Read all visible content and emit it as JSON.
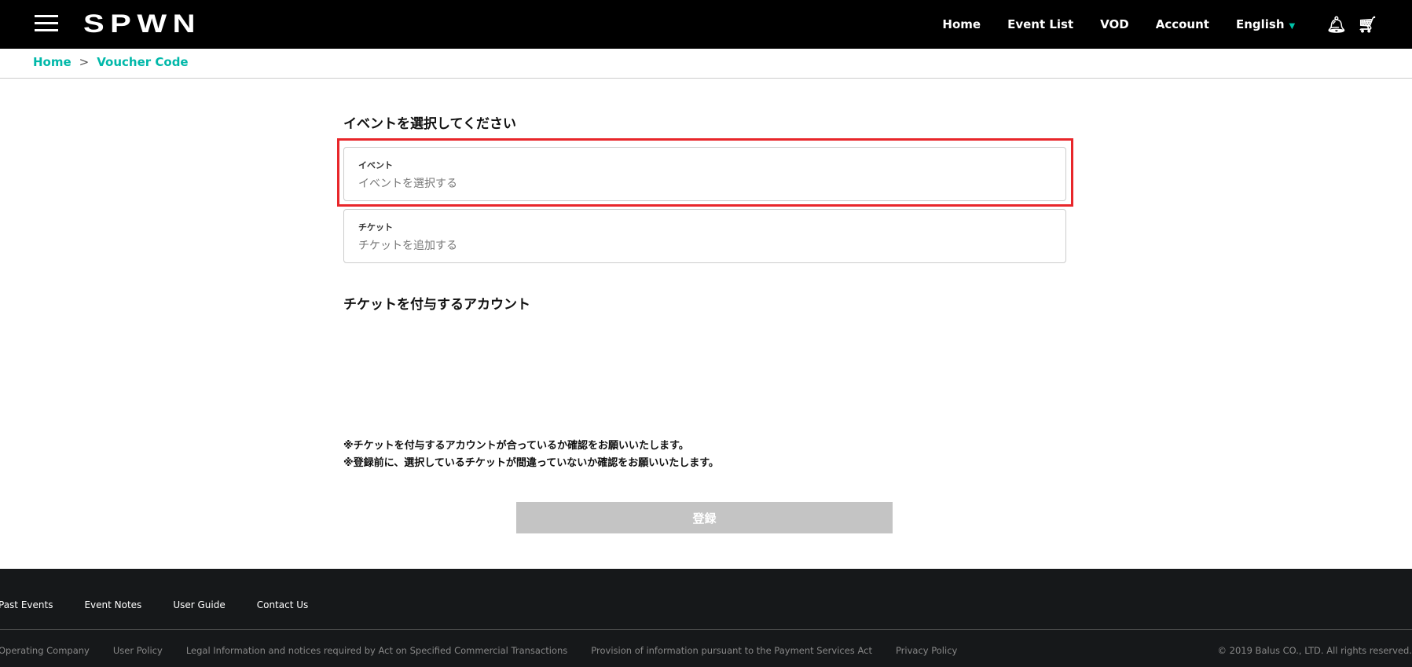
{
  "header": {
    "logo": "SPWN",
    "nav": [
      "Home",
      "Event List",
      "VOD",
      "Account"
    ],
    "language": "English",
    "accent": "#00b8a9"
  },
  "breadcrumb": {
    "home": "Home",
    "sep": ">",
    "current": "Voucher Code"
  },
  "main": {
    "select_heading": "イベントを選択してください",
    "event_field": {
      "label": "イベント",
      "placeholder": "イベントを選択する"
    },
    "ticket_field": {
      "label": "チケット",
      "placeholder": "チケットを追加する"
    },
    "account_heading": "チケットを付与するアカウント",
    "notes": [
      "※チケットを付与するアカウントが合っているか確認をお願いいたします。",
      "※登録前に、選択しているチケットが間違っていないか確認をお願いいたします。"
    ],
    "submit": "登録"
  },
  "footer": {
    "links": [
      "Past Events",
      "Event Notes",
      "User Guide",
      "Contact Us"
    ],
    "legal": [
      "Operating Company",
      "User Policy",
      "Legal Information and notices required by Act on Specified Commercial Transactions",
      "Provision of information pursuant to the Payment Services Act",
      "Privacy Policy"
    ],
    "copyright": "© 2019 Balus CO., LTD. All rights reserved."
  }
}
